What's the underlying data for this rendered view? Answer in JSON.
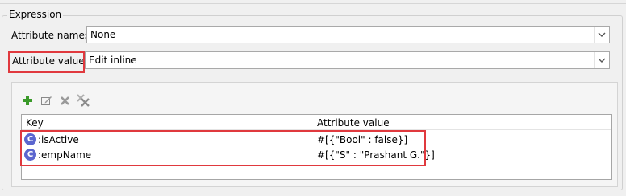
{
  "group": {
    "title": "Expression"
  },
  "attribute_names": {
    "label": "Attribute names",
    "value": "None"
  },
  "attribute_values": {
    "label": "Attribute values",
    "value": "Edit inline"
  },
  "toolbar": {
    "icons": [
      "add-icon",
      "edit-icon",
      "delete-icon",
      "delete-all-icon"
    ]
  },
  "table": {
    "headers": {
      "key": "Key",
      "value": "Attribute value"
    },
    "rows": [
      {
        "key": ":isActive",
        "value": "#[{\"Bool\" : false}]",
        "icon": "constant-icon"
      },
      {
        "key": ":empName",
        "value": "#[{\"S\" : \"Prashant G.\"}]",
        "icon": "constant-icon"
      }
    ]
  },
  "colors": {
    "highlight": "#e0393e",
    "icon_blue": "#5b66cf",
    "add_green": "#3a9a2a"
  }
}
